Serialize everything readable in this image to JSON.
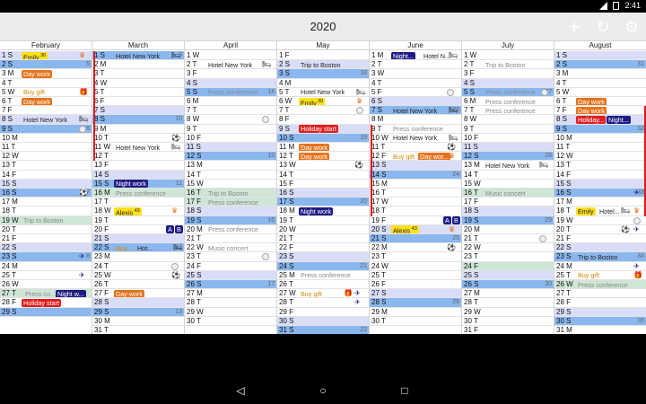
{
  "status_bar": {
    "time": "2:41"
  },
  "app": {
    "title": "2020"
  },
  "icons": {
    "add": "add-icon",
    "undo": "refresh-icon",
    "settings": "gear-icon",
    "back": "back-icon",
    "home": "home-icon",
    "recent": "recent-apps-icon"
  },
  "colors": {
    "accent": "#8ab7ee",
    "weekend_sat": "#d9ddf7",
    "holiday": "#cfe6d6",
    "today_line": "#d81b1b"
  },
  "months": [
    {
      "name": "February",
      "days": [
        "1 S",
        "2 S",
        "3 M",
        "4 T",
        "5 W",
        "6 T",
        "7 F",
        "8 S",
        "9 S",
        "10 M",
        "11 T",
        "12 W",
        "13 T",
        "14 F",
        "15 S",
        "16 S",
        "17 M",
        "18 T",
        "19 W",
        "20 T",
        "21 F",
        "22 S",
        "23 S",
        "24 M",
        "25 T",
        "26 W",
        "27 T",
        "28 F",
        "29 S"
      ]
    },
    {
      "name": "March",
      "days": [
        "1 S",
        "2 M",
        "3 T",
        "4 W",
        "5 T",
        "6 F",
        "7 S",
        "8 S",
        "9 M",
        "10 T",
        "11 W",
        "12 T",
        "13 F",
        "14 S",
        "15 S",
        "16 M",
        "17 T",
        "18 W",
        "19 T",
        "20 F",
        "21 S",
        "22 S",
        "23 M",
        "24 T",
        "25 W",
        "26 T",
        "27 F",
        "28 S",
        "29 S",
        "30 M",
        "31 T"
      ]
    },
    {
      "name": "April",
      "days": [
        "1 W",
        "2 T",
        "3 F",
        "4 S",
        "5 S",
        "6 M",
        "7 T",
        "8 W",
        "9 T",
        "10 F",
        "11 S",
        "12 S",
        "13 M",
        "14 T",
        "15 W",
        "16 T",
        "17 F",
        "18 S",
        "19 S",
        "20 M",
        "21 T",
        "22 W",
        "23 T",
        "24 F",
        "25 S",
        "26 S",
        "27 M",
        "28 T",
        "29 W",
        "30 T"
      ]
    },
    {
      "name": "May",
      "days": [
        "1 F",
        "2 S",
        "3 S",
        "4 M",
        "5 T",
        "6 W",
        "7 T",
        "8 F",
        "9 S",
        "10 S",
        "11 M",
        "12 T",
        "13 W",
        "14 T",
        "15 F",
        "16 S",
        "17 S",
        "18 M",
        "19 T",
        "20 W",
        "21 T",
        "22 F",
        "23 S",
        "24 S",
        "25 M",
        "26 T",
        "27 W",
        "28 T",
        "29 F",
        "30 S",
        "31 S"
      ]
    },
    {
      "name": "June",
      "days": [
        "1 M",
        "2 T",
        "3 W",
        "4 T",
        "5 F",
        "6 S",
        "7 S",
        "8 M",
        "9 T",
        "10 W",
        "11 T",
        "12 F",
        "13 S",
        "14 S",
        "15 M",
        "16 T",
        "17 W",
        "18 T",
        "19 F",
        "20 S",
        "21 S",
        "22 M",
        "23 T",
        "24 W",
        "25 T",
        "26 F",
        "27 S",
        "28 S",
        "29 M",
        "30 T"
      ]
    },
    {
      "name": "July",
      "days": [
        "1 W",
        "2 T",
        "3 F",
        "4 S",
        "5 S",
        "6 M",
        "7 T",
        "8 W",
        "9 T",
        "10 F",
        "11 S",
        "12 S",
        "13 M",
        "14 T",
        "15 W",
        "16 T",
        "17 F",
        "18 S",
        "19 S",
        "20 M",
        "21 T",
        "22 W",
        "23 T",
        "24 F",
        "25 S",
        "26 S",
        "27 M",
        "28 T",
        "29 W",
        "30 T",
        "31 F"
      ]
    },
    {
      "name": "August",
      "days": [
        "1 S",
        "2 S",
        "3 M",
        "4 T",
        "5 W",
        "6 T",
        "7 F",
        "8 S",
        "9 S",
        "10 M",
        "11 T",
        "12 W",
        "13 T",
        "14 F",
        "15 S",
        "16 S",
        "17 M",
        "18 T",
        "19 W",
        "20 T",
        "21 F",
        "22 S",
        "23 S",
        "24 M",
        "25 T",
        "26 W",
        "27 T",
        "28 F",
        "29 S",
        "30 S",
        "31 M"
      ]
    }
  ],
  "week_numbers": {
    "February": {
      "2": "5",
      "9": "6",
      "16": "7",
      "23": "8"
    },
    "March": {
      "1": "9",
      "8": "10",
      "15": "11",
      "22": "12",
      "29": "13"
    },
    "April": {
      "5": "14",
      "12": "15",
      "19": "16",
      "26": "17"
    },
    "May": {
      "3": "18",
      "10": "19",
      "17": "20",
      "24": "21",
      "31": "22"
    },
    "June": {
      "7": "23",
      "14": "24",
      "21": "25",
      "28": "26"
    },
    "July": {
      "5": "27",
      "12": "28",
      "19": "29",
      "26": "30"
    },
    "August": {
      "2": "31",
      "9": "32",
      "16": "33",
      "23": "34",
      "30": "35"
    }
  },
  "events": {
    "emily_feb": "Emily",
    "emily_feb_age": "30",
    "day_work": "Day work",
    "buy_gift": "Buy gift",
    "hotel_ny": "Hotel New York",
    "trip_boston": "Trip to Boston",
    "press_conf": "Press conference",
    "press_co": "Press co...",
    "night_work": "Night work",
    "night_w": "Night w...",
    "holiday_start": "Holiday start",
    "alexis": "Alexis",
    "alexis_age": "43",
    "buy_trunc": "Buy...",
    "hot_trunc": "Hot...",
    "music_concert": "Music concert",
    "emily_may": "Emily",
    "emily_may_age": "30",
    "night_n": "Night...",
    "hotel_n": "Hotel N...",
    "day_wor": "Day wor...",
    "holiday_trunc": "Holiday...",
    "night_trunc": "Night...",
    "emily_aug": "Emily",
    "hotel_aug": "Hotel...",
    "bday_a": "A",
    "bday_b": "B"
  }
}
